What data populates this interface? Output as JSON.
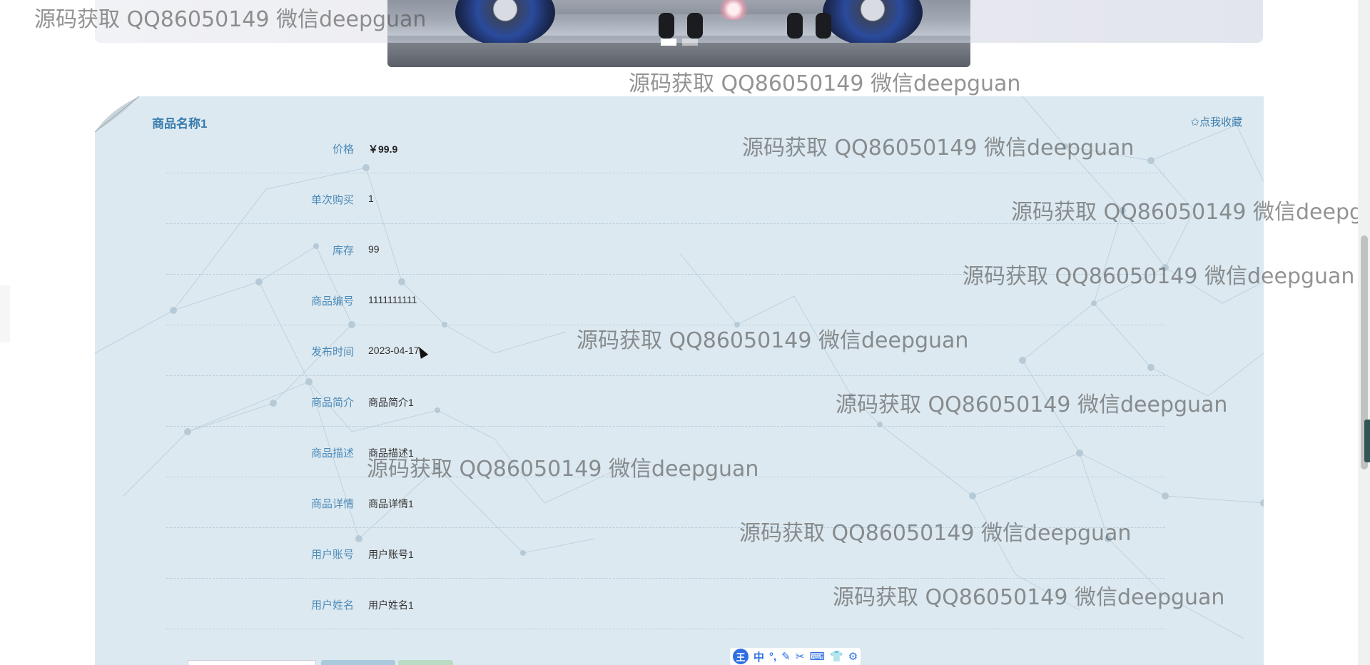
{
  "watermark_text": "源码获取 QQ86050149 微信deepguan",
  "product": {
    "title": "商品名称1",
    "favorite_label": "✩点我收藏",
    "fields": [
      {
        "label": "价格",
        "value": "￥99.9"
      },
      {
        "label": "单次购买",
        "value": "1"
      },
      {
        "label": "库存",
        "value": "99"
      },
      {
        "label": "商品编号",
        "value": "1111111111"
      },
      {
        "label": "发布时间",
        "value": "2023-04-17"
      },
      {
        "label": "商品简介",
        "value": "商品简介1"
      },
      {
        "label": "商品描述",
        "value": "商品描述1"
      },
      {
        "label": "商品详情",
        "value": "商品详情1"
      },
      {
        "label": "用户账号",
        "value": "用户账号1"
      },
      {
        "label": "用户姓名",
        "value": "用户姓名1"
      }
    ]
  },
  "ime_toolbar": {
    "logo": "王",
    "items": [
      "中",
      "°,",
      "✎",
      "✂",
      "⌨",
      "👕",
      "⚙"
    ]
  },
  "colors": {
    "label": "#4a8ab9",
    "title": "#3a7cad",
    "card_bg": "#dde9f0",
    "ime_blue": "#2f6fe3"
  }
}
